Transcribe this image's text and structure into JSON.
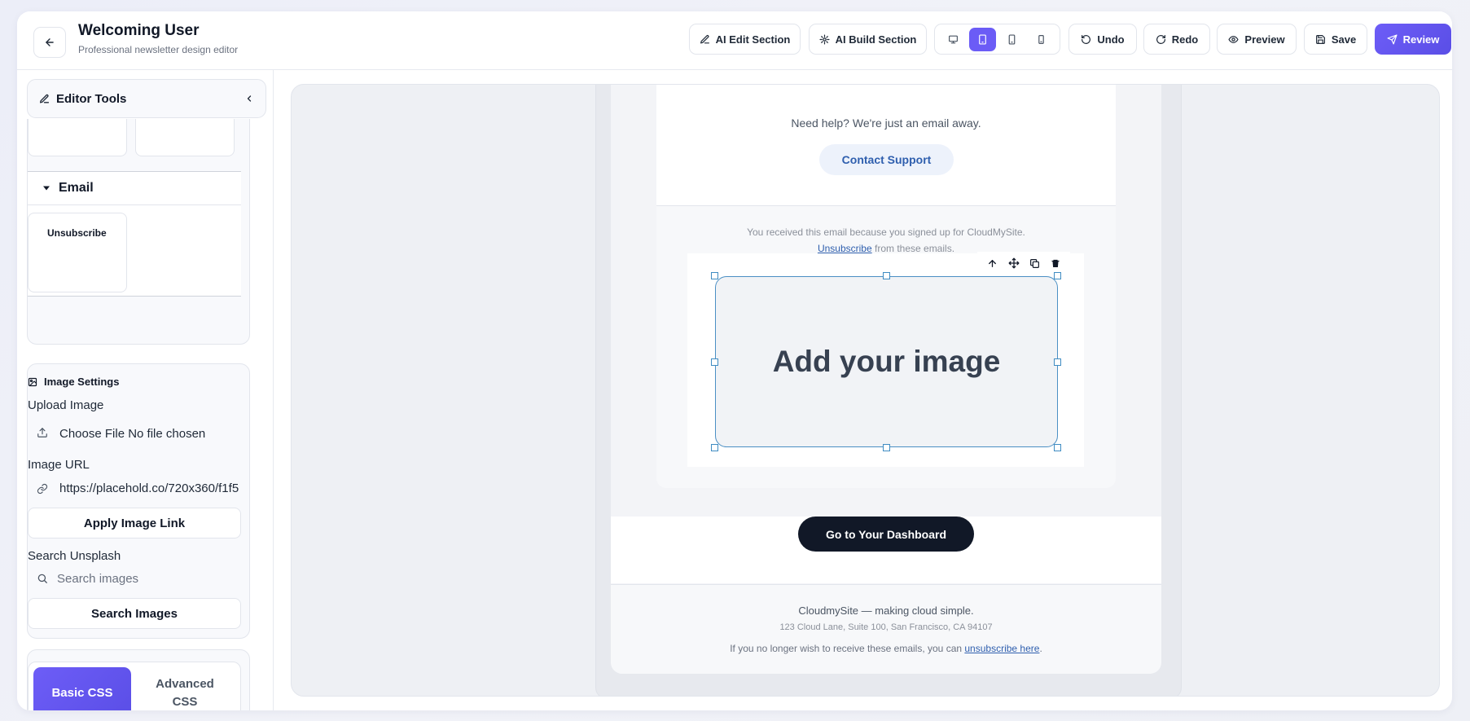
{
  "header": {
    "title": "Welcoming User",
    "subtitle": "Professional newsletter design editor",
    "buttons": {
      "ai_edit": "AI Edit Section",
      "ai_build": "AI Build Section",
      "undo": "Undo",
      "redo": "Redo",
      "preview": "Preview",
      "save": "Save",
      "review": "Review"
    },
    "device_views": [
      "desktop",
      "tablet",
      "mobile",
      "small-mobile"
    ],
    "active_device": "tablet"
  },
  "sidebar": {
    "title": "Editor Tools",
    "email_section": {
      "label": "Email",
      "tiles": [
        "Unsubscribe"
      ]
    },
    "image_settings": {
      "title": "Image Settings",
      "upload_label": "Upload Image",
      "choose_file": "Choose File No file chosen",
      "url_label": "Image URL",
      "url_value": "https://placehold.co/720x360/f1f5",
      "apply_button": "Apply Image Link",
      "search_label": "Search Unsplash",
      "search_placeholder": "Search images",
      "search_button": "Search Images"
    },
    "css_tabs": {
      "basic": "Basic CSS",
      "advanced": "Advanced CSS",
      "active": "basic"
    }
  },
  "email": {
    "help_text": "Need help? We're just an email away.",
    "contact_button": "Contact Support",
    "notice_line1": "You received this email because you signed up for CloudMySite.",
    "notice_unsubscribe_link": "Unsubscribe",
    "notice_line2_rest": " from these emails.",
    "image_placeholder": "Add your image",
    "dashboard_button": "Go to Your Dashboard",
    "footer": {
      "tagline": "CloudmySite — making cloud simple.",
      "address": "123 Cloud Lane, Suite 100, San Francisco, CA 94107",
      "unsub_prefix": "If you no longer wish to receive these emails, you can ",
      "unsub_link": "unsubscribe here",
      "unsub_suffix": "."
    }
  },
  "colors": {
    "accent": "#6b5cf6",
    "link": "#2f5fae",
    "dark_button": "#111827",
    "selection": "#3f8cc2"
  }
}
